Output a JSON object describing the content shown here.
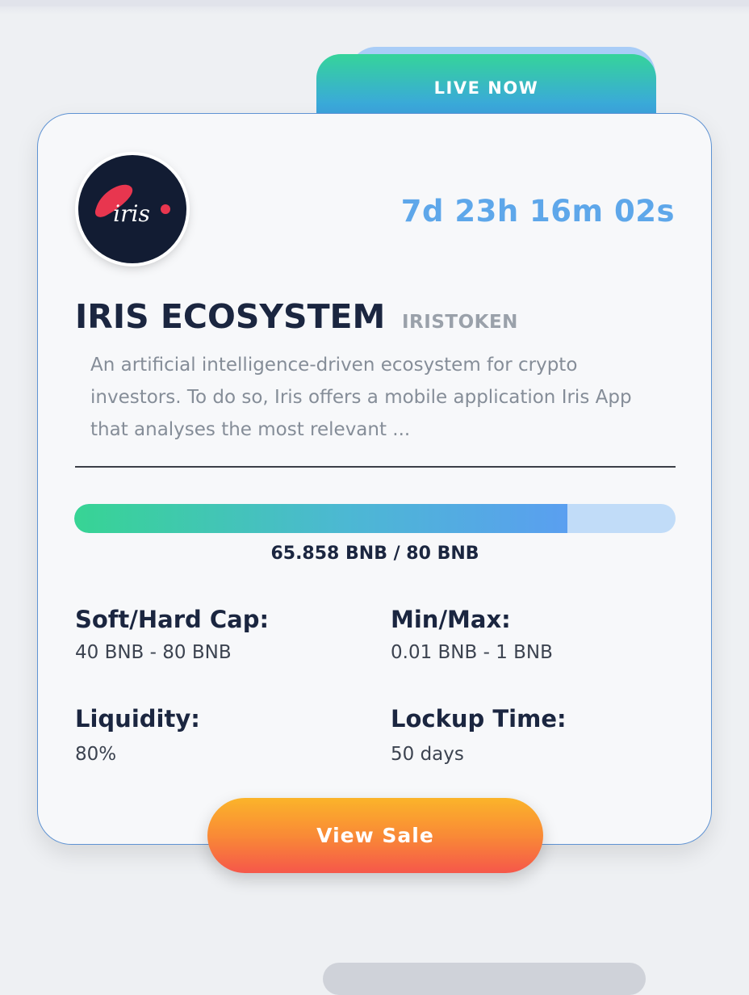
{
  "badge": {
    "label": "LIVE NOW"
  },
  "project": {
    "logo_text": "iris",
    "countdown": "7d 23h 16m 02s",
    "name": "IRIS ECOSYSTEM",
    "ticker": "IRISTOKEN",
    "description": "An artificial intelligence-driven ecosystem for crypto investors. To do so, Iris offers a mobile application Iris App that analyses the most relevant ..."
  },
  "progress": {
    "fraction": 0.82,
    "label": "65.858 BNB / 80 BNB"
  },
  "stats": {
    "soft_hard_cap": {
      "label": "Soft/Hard Cap:",
      "value": "40 BNB - 80 BNB"
    },
    "min_max": {
      "label": "Min/Max:",
      "value": "0.01 BNB - 1 BNB"
    },
    "liquidity": {
      "label": "Liquidity:",
      "value": "80%"
    },
    "lockup_time": {
      "label": "Lockup Time:",
      "value": "50 days"
    }
  },
  "cta": {
    "label": "View Sale"
  },
  "colors": {
    "accent_green": "#35d49a",
    "accent_blue": "#5ea7ea",
    "title": "#1b2640",
    "button_top": "#fbb42a",
    "button_bottom": "#f5574a",
    "logo_bg": "#121c33",
    "logo_red": "#e8364f"
  }
}
